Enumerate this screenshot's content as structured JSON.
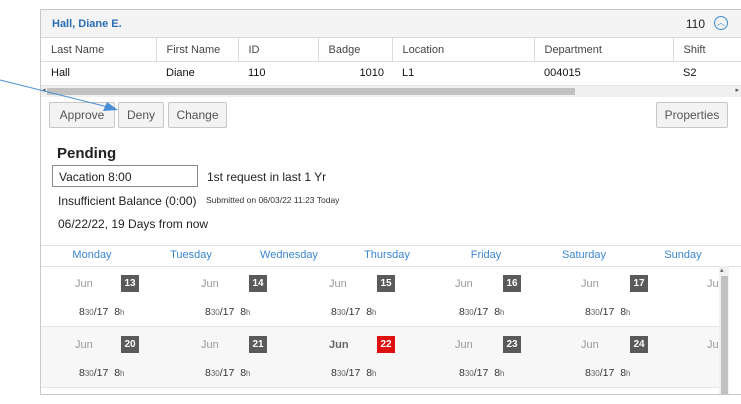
{
  "header": {
    "employee_name": "Hall, Diane E.",
    "employee_id": "110",
    "toggle_glyph": "︿"
  },
  "grid": {
    "columns": [
      "Last Name",
      "First Name",
      "ID",
      "Badge",
      "Location",
      "Department",
      "Shift"
    ],
    "row": {
      "last_name": "Hall",
      "first_name": "Diane",
      "id": "110",
      "badge": "1010",
      "location": "L1",
      "department": "004015",
      "shift": "S2"
    }
  },
  "toolbar": {
    "approve": "Approve",
    "deny": "Deny",
    "change": "Change",
    "properties": "Properties"
  },
  "request": {
    "status": "Pending",
    "type_value": "Vacation 8:00",
    "count_note": "1st request in last 1 Yr",
    "balance_note": "Insufficient Balance (0:00)",
    "submitted_note": "Submitted on 06/03/22 11:23 Today",
    "date_note": "06/22/22, 19 Days from now"
  },
  "calendar": {
    "day_names": [
      "Monday",
      "Tuesday",
      "Wednesday",
      "Thursday",
      "Friday",
      "Saturday",
      "Sunday"
    ],
    "month": "Jun",
    "sunday_month_partial": "Ju",
    "hours_main": "8",
    "hours_sub": "30",
    "hours_tail": "/17",
    "hours_right": "8",
    "hours_unit": "h",
    "week1": [
      "13",
      "14",
      "15",
      "16",
      "17"
    ],
    "week2": [
      "20",
      "21",
      "22",
      "23",
      "24"
    ],
    "today_label": "22"
  },
  "colors": {
    "accent": "#3b86d0",
    "today": "#e01010",
    "daybox": "#5a5a5a"
  }
}
